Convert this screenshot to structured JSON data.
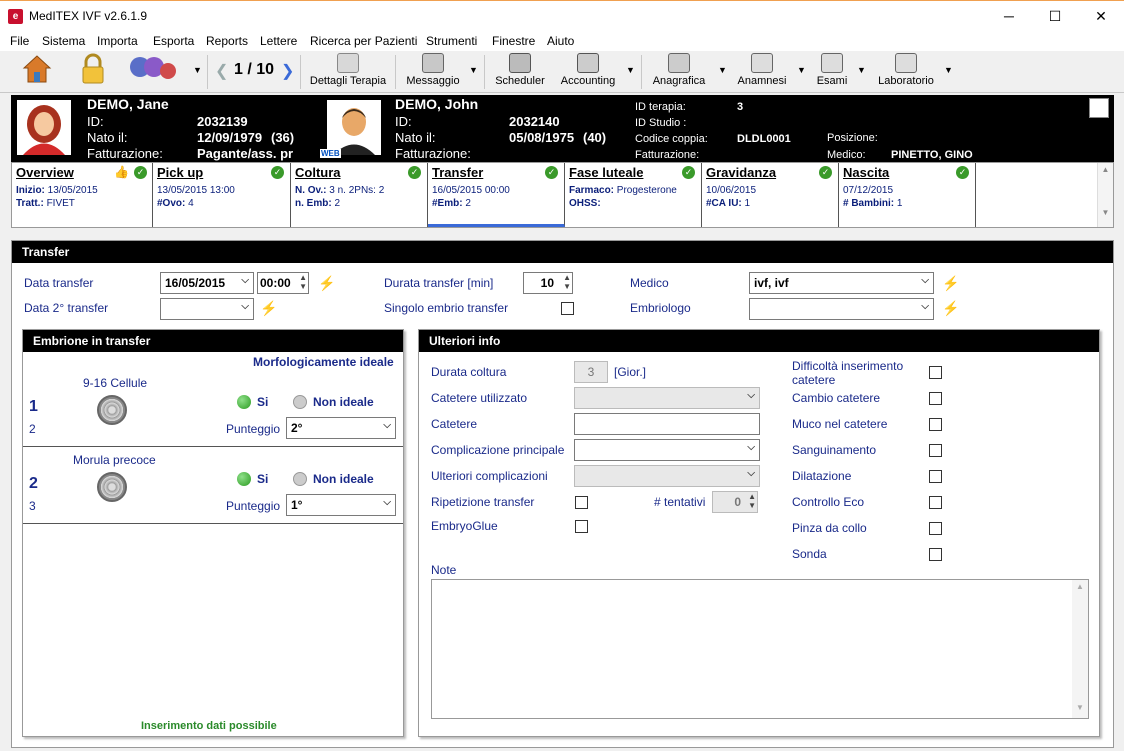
{
  "window": {
    "title": "MedITEX IVF v2.6.1.9",
    "minimize": "─",
    "maximize": "☐",
    "close": "✕"
  },
  "menu": [
    "File",
    "Sistema",
    "Importa",
    "Esporta",
    "Reports",
    "Lettere",
    "Ricerca per Pazienti",
    "Strumenti",
    "Finestre",
    "Aiuto"
  ],
  "toolbar": {
    "pager": "1 / 10",
    "dettagli": "Dettagli Terapia",
    "messaggio": "Messaggio",
    "scheduler": "Scheduler",
    "accounting": "Accounting",
    "anagrafica": "Anagrafica",
    "anamnesi": "Anamnesi",
    "esami": "Esami",
    "laboratorio": "Laboratorio"
  },
  "female": {
    "name": "DEMO, Jane",
    "id_label": "ID:",
    "id": "2032139",
    "born_label": "Nato il:",
    "born": "12/09/1979",
    "age": "(36)",
    "billing_label": "Fatturazione:",
    "billing": "Pagante/ass. pr"
  },
  "male": {
    "name": "DEMO, John",
    "id_label": "ID:",
    "id": "2032140",
    "born_label": "Nato il:",
    "born": "05/08/1975",
    "age": "(40)",
    "billing_label": "Fatturazione:",
    "web": "WEB"
  },
  "therapy": {
    "id_label": "ID terapia:",
    "id": "3",
    "study_label": "ID Studio :",
    "couple_label": "Codice coppia:",
    "couple": "DLDL0001",
    "billing_label": "Fatturazione:",
    "position_label": "Posizione:",
    "doctor_label": "Medico:",
    "doctor": "PINETTO, GINO"
  },
  "steps": [
    {
      "title": "Overview",
      "l1k": "Inizio:",
      "l1v": "13/05/2015",
      "l2k": "Tratt.:",
      "l2v": "FIVET"
    },
    {
      "title": "Pick up",
      "l1k": "",
      "l1v": "13/05/2015 13:00",
      "l2k": "#Ovo:",
      "l2v": "4"
    },
    {
      "title": "Coltura",
      "l1k": "N. Ov.:",
      "l1v": "3 n. 2PNs: 2",
      "l2k": "n. Emb:",
      "l2v": "2"
    },
    {
      "title": "Transfer",
      "l1k": "",
      "l1v": "16/05/2015 00:00",
      "l2k": "#Emb:",
      "l2v": "2"
    },
    {
      "title": "Fase luteale",
      "l1k": "Farmaco:",
      "l1v": "Progesterone",
      "l2k": "OHSS:",
      "l2v": ""
    },
    {
      "title": "Gravidanza",
      "l1k": "",
      "l1v": "10/06/2015",
      "l2k": "#CA IU:",
      "l2v": "1"
    },
    {
      "title": "Nascita",
      "l1k": "",
      "l1v": "07/12/2015",
      "l2k": "# Bambini:",
      "l2v": "1"
    }
  ],
  "transfer": {
    "header": "Transfer",
    "data_label": "Data transfer",
    "data_value": "16/05/2015",
    "time_value": "00:00",
    "data2_label": "Data 2° transfer",
    "durata_label": "Durata transfer [min]",
    "durata_value": "10",
    "singolo_label": "Singolo embrio transfer",
    "medico_label": "Medico",
    "medico_value": "ivf, ivf",
    "embriologo_label": "Embriologo"
  },
  "embryo_panel": {
    "header": "Embrione in transfer",
    "subtitle": "Morfologicamente ideale",
    "si": "Si",
    "non_ideale": "Non ideale",
    "punteggio": "Punteggio",
    "footer": "Inserimento dati possibile",
    "embryos": [
      {
        "num": "1",
        "sub": "2",
        "stage": "9-16 Cellule",
        "score": "2°"
      },
      {
        "num": "2",
        "sub": "3",
        "stage": "Morula precoce",
        "score": "1°"
      }
    ]
  },
  "info_panel": {
    "header": "Ulteriori info",
    "durata_label": "Durata coltura",
    "durata_value": "3",
    "durata_unit": "[Gior.]",
    "catetere_utilizzato": "Catetere utilizzato",
    "catetere": "Catetere",
    "complicazione": "Complicazione principale",
    "ulteriori": "Ulteriori complicazioni",
    "ripetizione": "Ripetizione transfer",
    "tentativi_label": "# tentativi",
    "tentativi_value": "0",
    "embryoglue": "EmbryoGlue",
    "note": "Note",
    "right": [
      "Difficoltà inserimento catetere",
      "Cambio catetere",
      "Muco nel catetere",
      "Sanguinamento",
      "Dilatazione",
      "Controllo Eco",
      "Pinza da collo",
      "Sonda"
    ]
  }
}
